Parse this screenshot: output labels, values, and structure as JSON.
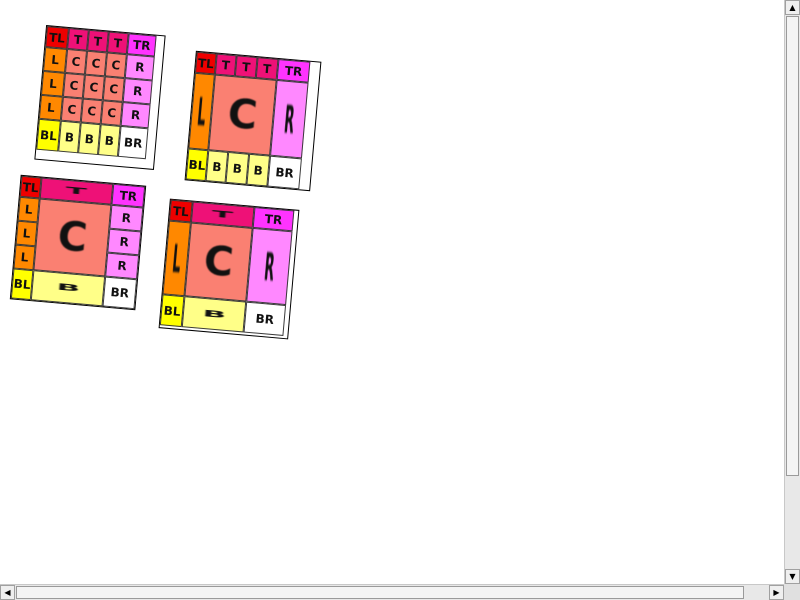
{
  "grids": {
    "g1": {
      "row0": [
        "TL",
        "T",
        "T",
        "T",
        "TR"
      ],
      "row1": [
        "L",
        "C",
        "C",
        "C",
        "R"
      ],
      "row2": [
        "L",
        "C",
        "C",
        "C",
        "R"
      ],
      "row3": [
        "L",
        "C",
        "C",
        "C",
        "R"
      ],
      "row4": [
        "BL",
        "B",
        "B",
        "B",
        "BR"
      ]
    },
    "g2": {
      "row0": [
        "TL",
        "T",
        "T",
        "T",
        "TR"
      ],
      "mid": [
        "L",
        "C",
        "R"
      ],
      "row2": [
        "BL",
        "B",
        "B",
        "B",
        "BR"
      ]
    },
    "g3": {
      "row0": [
        "TL",
        "T",
        "TR"
      ],
      "left": [
        "L",
        "L",
        "L"
      ],
      "center": "C",
      "right": [
        "R",
        "R",
        "R"
      ],
      "row2": [
        "BL",
        "B",
        "BR"
      ]
    },
    "g4": {
      "row0": [
        "TL",
        "T",
        "TR"
      ],
      "mid": [
        "L",
        "C",
        "R"
      ],
      "row2": [
        "BL",
        "B",
        "BR"
      ]
    }
  },
  "scrollbar": {
    "up_arrow": "▲",
    "down_arrow": "▼",
    "left_arrow": "◀",
    "right_arrow": "▶"
  }
}
